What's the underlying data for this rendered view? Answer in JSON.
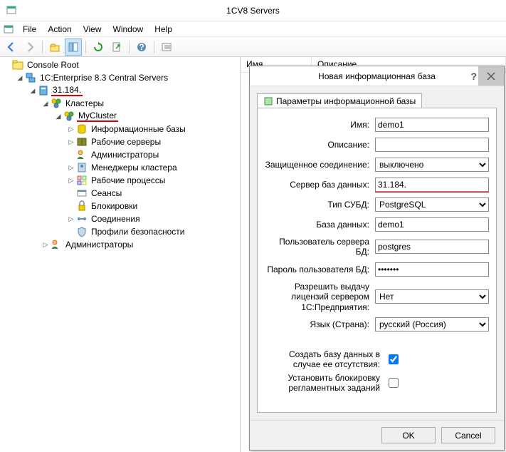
{
  "window": {
    "title": "1CV8 Servers"
  },
  "menu": {
    "file": "File",
    "action": "Action",
    "view": "View",
    "window": "Window",
    "help": "Help"
  },
  "tree": {
    "root": "Console Root",
    "central": "1C:Enterprise 8.3 Central Servers",
    "server": "31.184.",
    "clusters": "Кластеры",
    "mycluster": "MyCluster",
    "infobases": "Информационные базы",
    "workservers": "Рабочие серверы",
    "admins": "Администраторы",
    "clusterManagers": "Менеджеры кластера",
    "workprocesses": "Рабочие процессы",
    "sessions": "Сеансы",
    "locks": "Блокировки",
    "connections": "Соединения",
    "securityProfiles": "Профили безопасности",
    "adminsTop": "Администраторы"
  },
  "list": {
    "col1": "Имя",
    "col2": "Описание"
  },
  "dialog": {
    "title": "Новая информационная база",
    "tab": "Параметры информационной базы",
    "labels": {
      "name": "Имя:",
      "desc": "Описание:",
      "secure": "Защищенное соединение:",
      "dbserver": "Сервер баз данных:",
      "dbtype": "Тип СУБД:",
      "dbname": "База данных:",
      "dbuser": "Пользователь сервера БД:",
      "dbpass": "Пароль пользователя БД:",
      "license": "Разрешить выдачу лицензий сервером 1С:Предприятия:",
      "lang": "Язык (Страна):",
      "createdb": "Создать базу данных в случае ее отсутствия:",
      "block": "Установить блокировку регламентных заданий"
    },
    "values": {
      "name": "demo1",
      "desc": "",
      "secure": "выключено",
      "dbserver": "31.184.",
      "dbtype": "PostgreSQL",
      "dbname": "demo1",
      "dbuser": "postgres",
      "dbpass": "*******",
      "license": "Нет",
      "lang": "русский (Россия)"
    },
    "ok": "OK",
    "cancel": "Cancel"
  }
}
